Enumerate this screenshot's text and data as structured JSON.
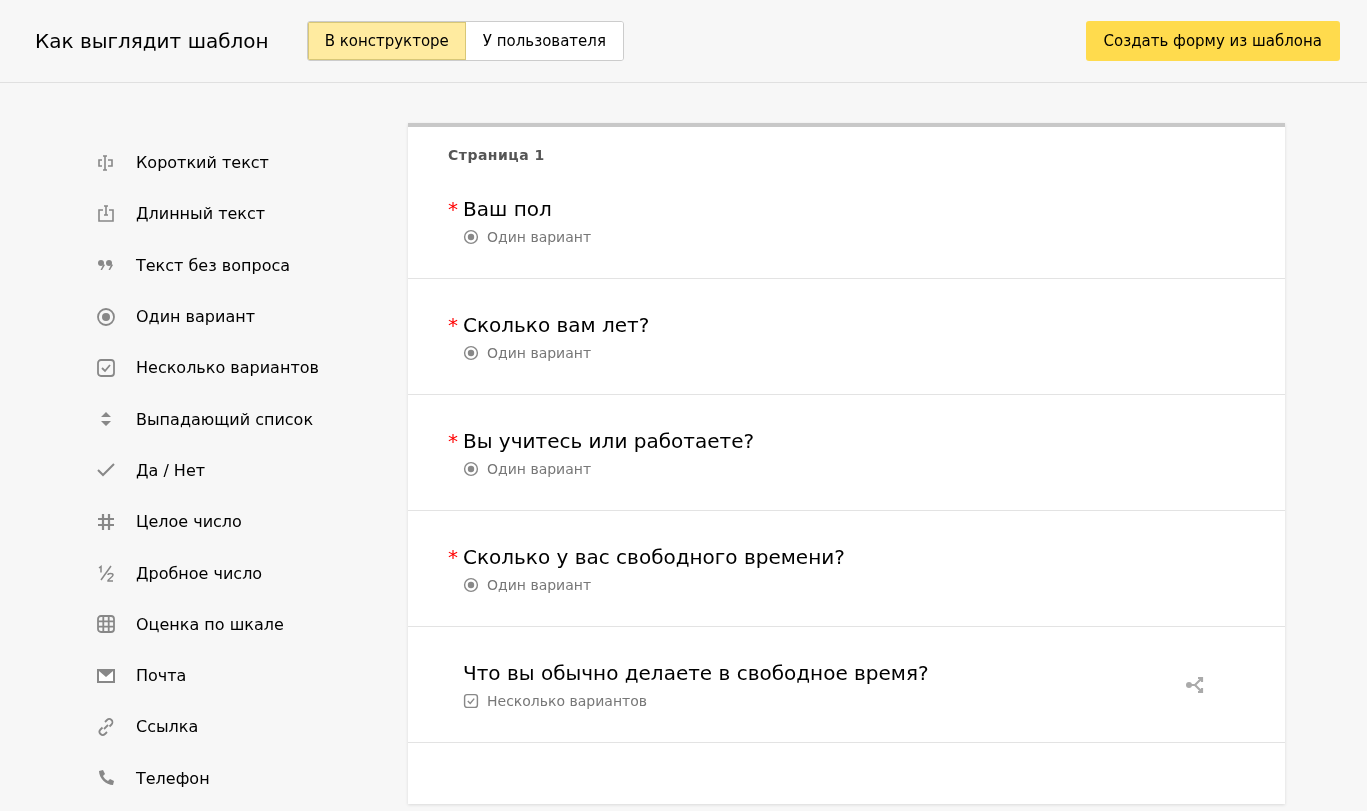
{
  "header": {
    "title": "Как выглядит шаблон",
    "tabs": [
      {
        "label": "В конструкторе",
        "selected": true
      },
      {
        "label": "У пользователя",
        "selected": false
      }
    ],
    "create_button": "Создать форму из шаблона"
  },
  "sidebar": {
    "items": [
      {
        "kind": "short",
        "label": "Короткий текст"
      },
      {
        "kind": "long",
        "label": "Длинный текст"
      },
      {
        "kind": "quote",
        "label": "Текст без вопроса"
      },
      {
        "kind": "radio",
        "label": "Один вариант"
      },
      {
        "kind": "checkbox",
        "label": "Несколько вариантов"
      },
      {
        "kind": "dropdown",
        "label": "Выпадающий список"
      },
      {
        "kind": "yesno",
        "label": "Да / Нет"
      },
      {
        "kind": "integer",
        "label": "Целое число"
      },
      {
        "kind": "fraction",
        "label": "Дробное число"
      },
      {
        "kind": "scale",
        "label": "Оценка по шкале"
      },
      {
        "kind": "mail",
        "label": "Почта"
      },
      {
        "kind": "link",
        "label": "Ссылка"
      },
      {
        "kind": "phone",
        "label": "Телефон"
      }
    ]
  },
  "form": {
    "page_label": "Страница 1",
    "questions": [
      {
        "title": "Ваш пол",
        "required_mark": "*",
        "kind": "radio",
        "type_label": "Один вариант",
        "branching": false
      },
      {
        "title": "Сколько вам лет?",
        "required_mark": "*",
        "kind": "radio",
        "type_label": "Один вариант",
        "branching": false
      },
      {
        "title": "Вы учитесь или работаете?",
        "required_mark": "*",
        "kind": "radio",
        "type_label": "Один вариант",
        "branching": false
      },
      {
        "title": "Сколько у вас свободного времени?",
        "required_mark": "*",
        "kind": "radio",
        "type_label": "Один вариант",
        "branching": false
      },
      {
        "title": "Что вы обычно делаете в свободное время?",
        "kind": "checkbox",
        "type_label": "Несколько вариантов",
        "branching": true
      }
    ]
  }
}
